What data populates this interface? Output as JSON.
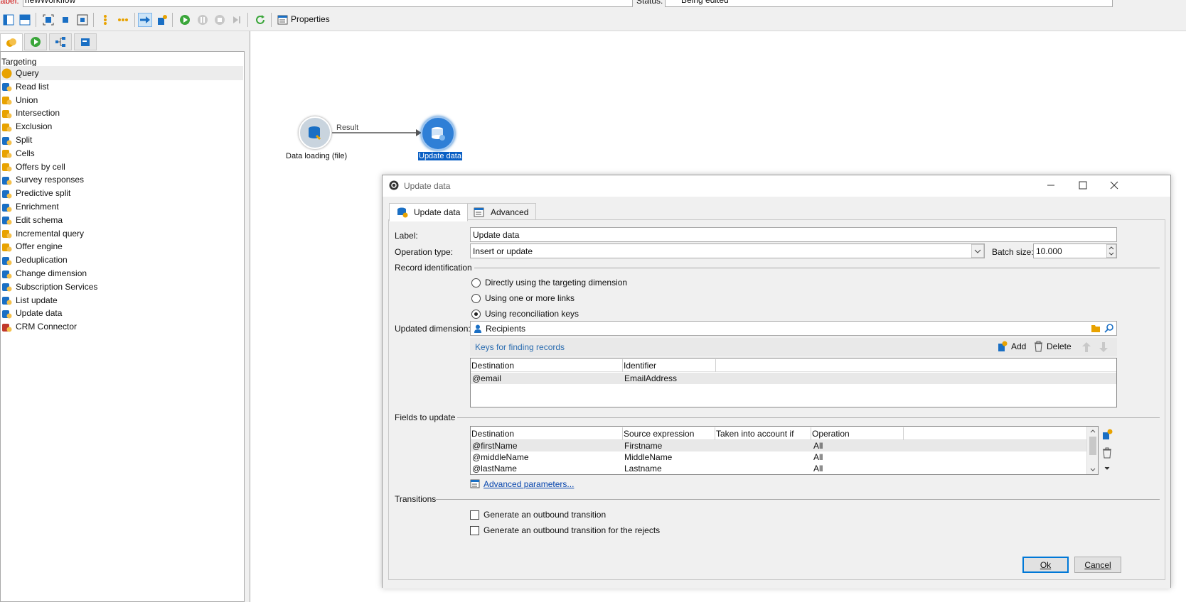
{
  "top": {
    "label_caption": "Label:",
    "label_value": "newWorkflow",
    "status_caption": "Status:",
    "status_value": "Being edited"
  },
  "toolbar": {
    "properties_label": "Properties"
  },
  "palette": {
    "title": "Targeting",
    "items": [
      {
        "label": "Query",
        "icon": "query-icon"
      },
      {
        "label": "Read list",
        "icon": "read-list-icon"
      },
      {
        "label": "Union",
        "icon": "union-icon"
      },
      {
        "label": "Intersection",
        "icon": "intersection-icon"
      },
      {
        "label": "Exclusion",
        "icon": "exclusion-icon"
      },
      {
        "label": "Split",
        "icon": "split-icon"
      },
      {
        "label": "Cells",
        "icon": "cells-icon"
      },
      {
        "label": "Offers by cell",
        "icon": "offers-by-cell-icon"
      },
      {
        "label": "Survey responses",
        "icon": "survey-icon"
      },
      {
        "label": "Predictive split",
        "icon": "predictive-split-icon"
      },
      {
        "label": "Enrichment",
        "icon": "enrichment-icon"
      },
      {
        "label": "Edit schema",
        "icon": "edit-schema-icon"
      },
      {
        "label": "Incremental query",
        "icon": "incremental-query-icon"
      },
      {
        "label": "Offer engine",
        "icon": "offer-engine-icon"
      },
      {
        "label": "Deduplication",
        "icon": "deduplication-icon"
      },
      {
        "label": "Change dimension",
        "icon": "change-dimension-icon"
      },
      {
        "label": "Subscription Services",
        "icon": "subscription-icon"
      },
      {
        "label": "List update",
        "icon": "list-update-icon"
      },
      {
        "label": "Update data",
        "icon": "update-data-icon"
      },
      {
        "label": "CRM Connector",
        "icon": "crm-connector-icon"
      }
    ]
  },
  "canvas": {
    "node1_label": "Data loading (file)",
    "transition_label": "Result",
    "node2_label": "Update data"
  },
  "dialog": {
    "title": "Update data",
    "tabs": [
      "Update data",
      "Advanced"
    ],
    "label_caption": "Label:",
    "label_value": "Update data",
    "operation_caption": "Operation type:",
    "operation_value": "Insert or update",
    "batch_caption": "Batch size:",
    "batch_value": "10.000",
    "record_id_caption": "Record identification",
    "radio_options": [
      "Directly using the targeting dimension",
      "Using one or more links",
      "Using reconciliation keys"
    ],
    "radio_selected": 2,
    "dimension_caption": "Updated dimension:",
    "dimension_value": "Recipients",
    "keys_caption": "Keys for finding records",
    "add_label": "Add",
    "delete_label": "Delete",
    "keys_columns": [
      "Destination",
      "Identifier"
    ],
    "keys_rows": [
      [
        "@email",
        "EmailAddress"
      ]
    ],
    "fields_caption": "Fields to update",
    "fields_columns": [
      "Destination",
      "Source expression",
      "Taken into account if",
      "Operation"
    ],
    "fields_rows": [
      [
        "@firstName",
        "Firstname",
        "",
        "All"
      ],
      [
        "@middleName",
        "MiddleName",
        "",
        "All"
      ],
      [
        "@lastName",
        "Lastname",
        "",
        "All"
      ]
    ],
    "advanced_params": "Advanced parameters...",
    "transitions_caption": "Transitions",
    "check_outbound": "Generate an outbound transition",
    "check_rejects": "Generate an outbound transition for the rejects",
    "ok_label": "Ok",
    "cancel_label": "Cancel"
  }
}
